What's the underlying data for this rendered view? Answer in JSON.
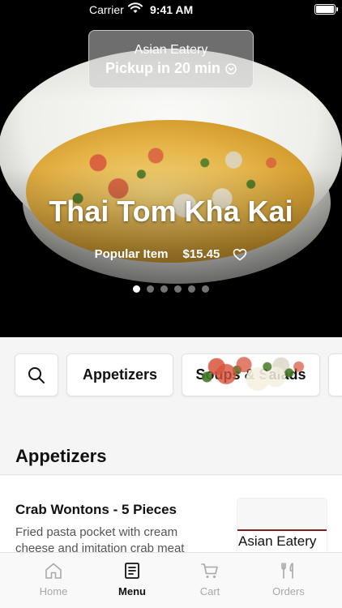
{
  "status_bar": {
    "carrier": "Carrier",
    "time": "9:41 AM"
  },
  "hero": {
    "restaurant_name": "Asian Eatery",
    "pickup_label": "Pickup in 20 min",
    "dish_title": "Thai Tom Kha Kai",
    "tag": "Popular Item",
    "price": "$15.45",
    "carousel_pages": 6,
    "carousel_active_index": 0
  },
  "categories": {
    "search_icon": "search-icon",
    "items": [
      "Appetizers",
      "Soups & Salads"
    ]
  },
  "section": {
    "title": "Appetizers"
  },
  "menu_item": {
    "name": "Crab Wontons - 5 Pieces",
    "description": "Fried pasta pocket with cream cheese and imitation crab meat",
    "image_logo_text": "Asian Eatery"
  },
  "tab_bar": {
    "tabs": [
      {
        "label": "Home",
        "icon": "home-icon"
      },
      {
        "label": "Menu",
        "icon": "menu-icon"
      },
      {
        "label": "Cart",
        "icon": "cart-icon"
      },
      {
        "label": "Orders",
        "icon": "orders-icon"
      }
    ],
    "active_index": 1
  },
  "colors": {
    "hero_bg": "#000000",
    "active_tab": "#111111",
    "inactive_tab": "#a8a8a8",
    "logo_rule": "#7a1e1e"
  }
}
